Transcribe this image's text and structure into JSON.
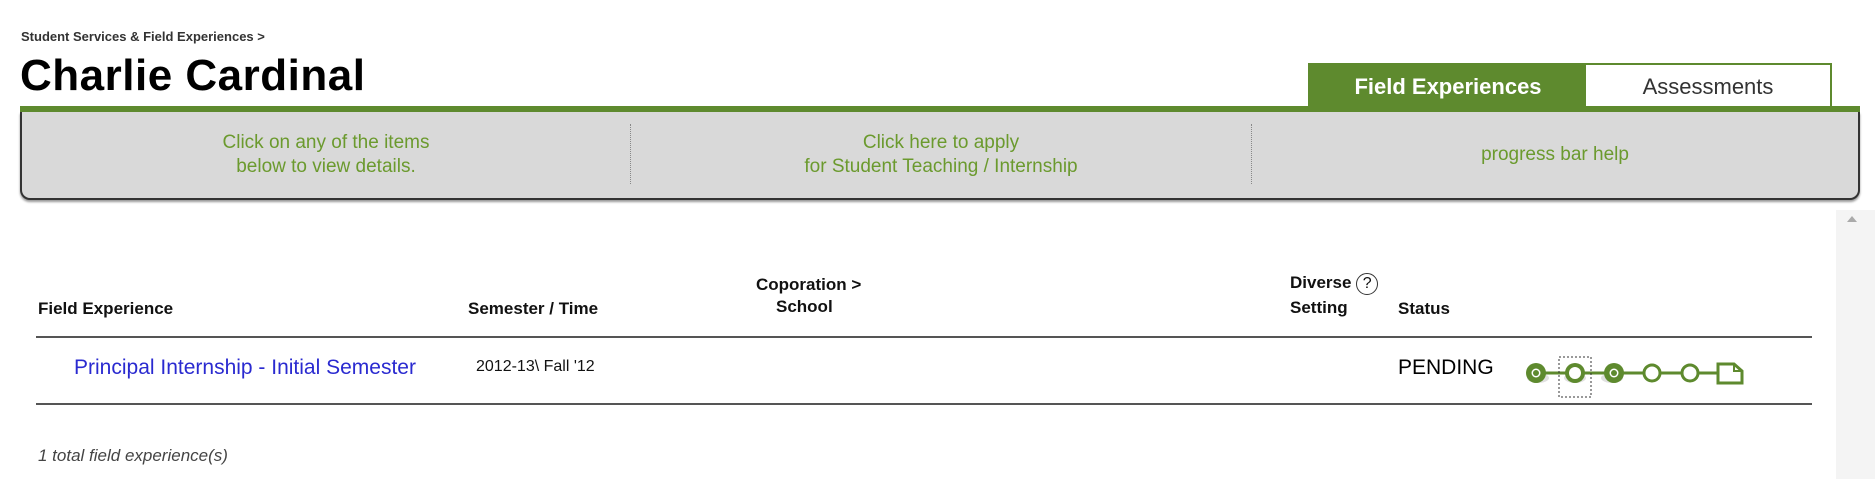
{
  "breadcrumb": "Student Services & Field Experiences >",
  "page_title": "Charlie Cardinal",
  "tabs": [
    {
      "label": "Field Experiences",
      "active": true
    },
    {
      "label": "Assessments",
      "active": false
    }
  ],
  "info_bar": {
    "details_line1": "Click on any of the items",
    "details_line2": "below to view details.",
    "apply_line1": "Click here to apply",
    "apply_line2": "for Student Teaching / Internship",
    "help": "progress bar help"
  },
  "table": {
    "headers": {
      "field_experience": "Field Experience",
      "semester": "Semester / Time",
      "corporation_line1": "Coporation >",
      "corporation_line2": "School",
      "diverse_line1": "Diverse",
      "diverse_line2": "Setting",
      "diverse_help": "?",
      "status": "Status"
    },
    "rows": [
      {
        "field_experience": "Principal Internship - Initial Semester",
        "semester": "2012-13\\ Fall '12",
        "corporation": "",
        "diverse_setting": "",
        "status": "PENDING",
        "progress_steps": [
          "filled",
          "empty-selected",
          "filled",
          "empty",
          "empty",
          "document"
        ]
      }
    ]
  },
  "total_text": "1 total field experience(s)",
  "colors": {
    "accent_green": "#5e8a2e",
    "info_text_green": "#6b9a2e",
    "link_blue": "#2a2ad0",
    "bar_gray": "#d9d9d9"
  }
}
